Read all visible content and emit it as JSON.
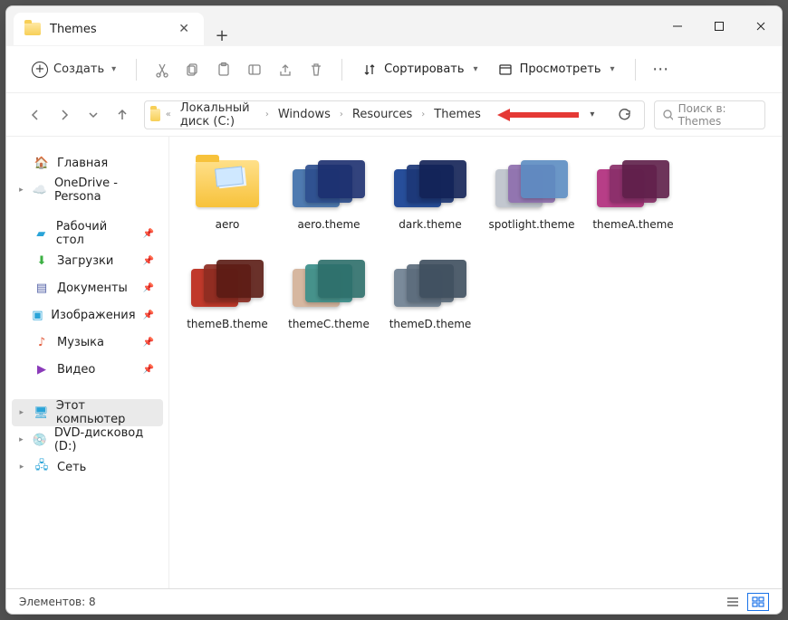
{
  "window": {
    "title": "Themes"
  },
  "toolbar": {
    "create": "Создать",
    "sort": "Сортировать",
    "view": "Просмотреть"
  },
  "breadcrumbs": [
    "Локальный диск (C:)",
    "Windows",
    "Resources",
    "Themes"
  ],
  "search": {
    "placeholder": "Поиск в: Themes"
  },
  "sidebar": {
    "home": "Главная",
    "onedrive": "OneDrive - Persona",
    "desktop": "Рабочий стол",
    "downloads": "Загрузки",
    "documents": "Документы",
    "pictures": "Изображения",
    "music": "Музыка",
    "videos": "Видео",
    "thispc": "Этот компьютер",
    "dvd": "DVD-дисковод (D:)",
    "network": "Сеть"
  },
  "items": [
    {
      "name": "aero",
      "kind": "folder"
    },
    {
      "name": "aero.theme",
      "kind": "theme",
      "hue1": "#4e7ab0",
      "hue2": "#2e4f8f",
      "hue3": "#1c2f6f"
    },
    {
      "name": "dark.theme",
      "kind": "theme",
      "hue1": "#274e9a",
      "hue2": "#1d3878",
      "hue3": "#122256"
    },
    {
      "name": "spotlight.theme",
      "kind": "theme",
      "hue1": "#c2c7cf",
      "hue2": "#8f6fae",
      "hue3": "#5c8cc2"
    },
    {
      "name": "themeA.theme",
      "kind": "theme",
      "hue1": "#b73e87",
      "hue2": "#8a2f6a",
      "hue3": "#5e1f49"
    },
    {
      "name": "themeB.theme",
      "kind": "theme",
      "hue1": "#c0392b",
      "hue2": "#8e2c22",
      "hue3": "#5a1b14"
    },
    {
      "name": "themeC.theme",
      "kind": "theme",
      "hue1": "#d6b7a0",
      "hue2": "#3a8f8a",
      "hue3": "#2d6e6a"
    },
    {
      "name": "themeD.theme",
      "kind": "theme",
      "hue1": "#7a8a9a",
      "hue2": "#5c6c7c",
      "hue3": "#3e4e5e"
    }
  ],
  "status": {
    "count_label": "Элементов: 8"
  }
}
